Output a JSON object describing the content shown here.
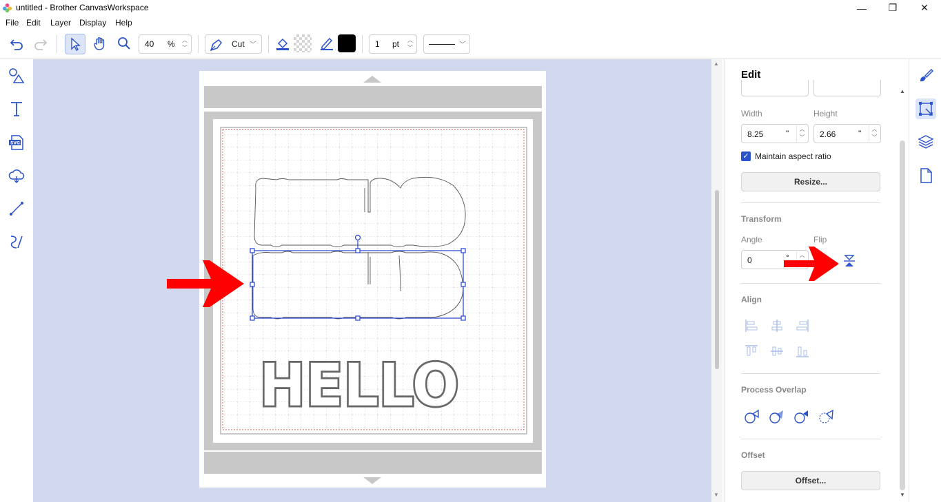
{
  "window": {
    "title": "untitled - Brother CanvasWorkspace",
    "controls": {
      "minimize": "—",
      "restore": "❐",
      "close": "✕"
    }
  },
  "menu": [
    "File",
    "Edit",
    "Layer",
    "Display",
    "Help"
  ],
  "toolbar": {
    "zoom_value": "40",
    "zoom_unit": "%",
    "mode_label": "Cut",
    "line_width_value": "1",
    "line_width_unit": "pt",
    "fill_color": "#000000"
  },
  "canvas": {
    "text_art": "HELLO"
  },
  "edit_panel": {
    "title": "Edit",
    "width_label": "Width",
    "height_label": "Height",
    "width_value": "8.25",
    "height_value": "2.66",
    "size_unit": "\"",
    "maintain_aspect_label": "Maintain aspect ratio",
    "maintain_aspect_checked": true,
    "resize_button": "Resize...",
    "transform_label": "Transform",
    "angle_label": "Angle",
    "angle_value": "0",
    "angle_unit": "°",
    "flip_label": "Flip",
    "align_label": "Align",
    "process_overlap_label": "Process Overlap",
    "offset_label": "Offset",
    "offset_button": "Offset..."
  },
  "colors": {
    "accent": "#1f3fd1",
    "annotation_arrow": "#ff0000",
    "canvas_bg": "#d2d9ef"
  }
}
